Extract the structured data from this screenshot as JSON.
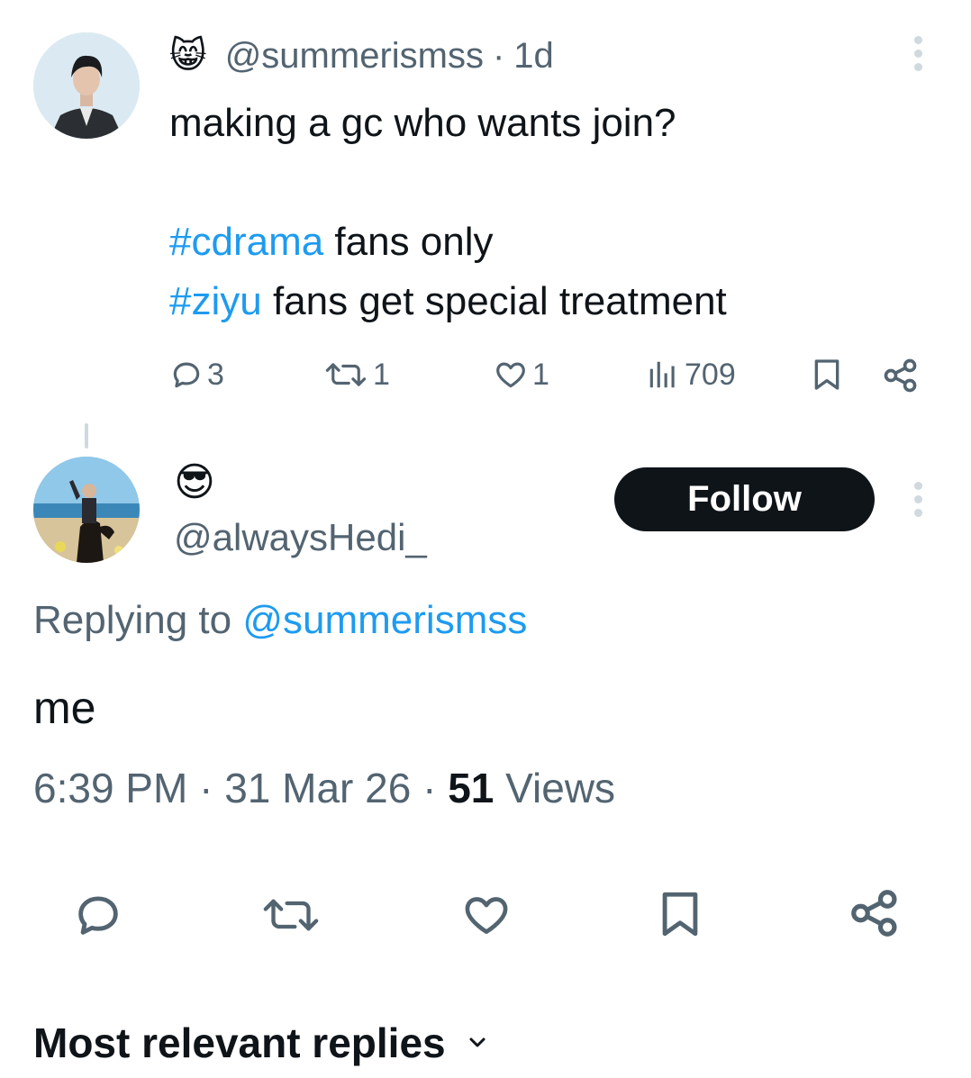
{
  "parent_tweet": {
    "emoji": "😸",
    "handle": "@summerismss",
    "separator": "·",
    "time": "1d",
    "text_line1": "making a gc who wants join?",
    "hashtag1": "#cdrama",
    "line2_rest": " fans only",
    "hashtag2": "#ziyu",
    "line3_rest": " fans get special treatment",
    "replies": "3",
    "reposts": "1",
    "likes": "1",
    "views": "709"
  },
  "reply_tweet": {
    "emoji": "😎",
    "handle": "@alwaysHedi_",
    "follow_label": "Follow",
    "replying_prefix": "Replying to ",
    "replying_handle": "@summerismss",
    "text": "me",
    "time": "6:39 PM",
    "sep1": "·",
    "date": "31 Mar 26",
    "sep2": "·",
    "views_count": "51",
    "views_label": " Views"
  },
  "replies_sort": {
    "label": "Most relevant replies"
  },
  "colors": {
    "accent": "#1d9bf0",
    "text": "#0f1419",
    "secondary": "#536471",
    "follow_bg": "#0f1419"
  }
}
